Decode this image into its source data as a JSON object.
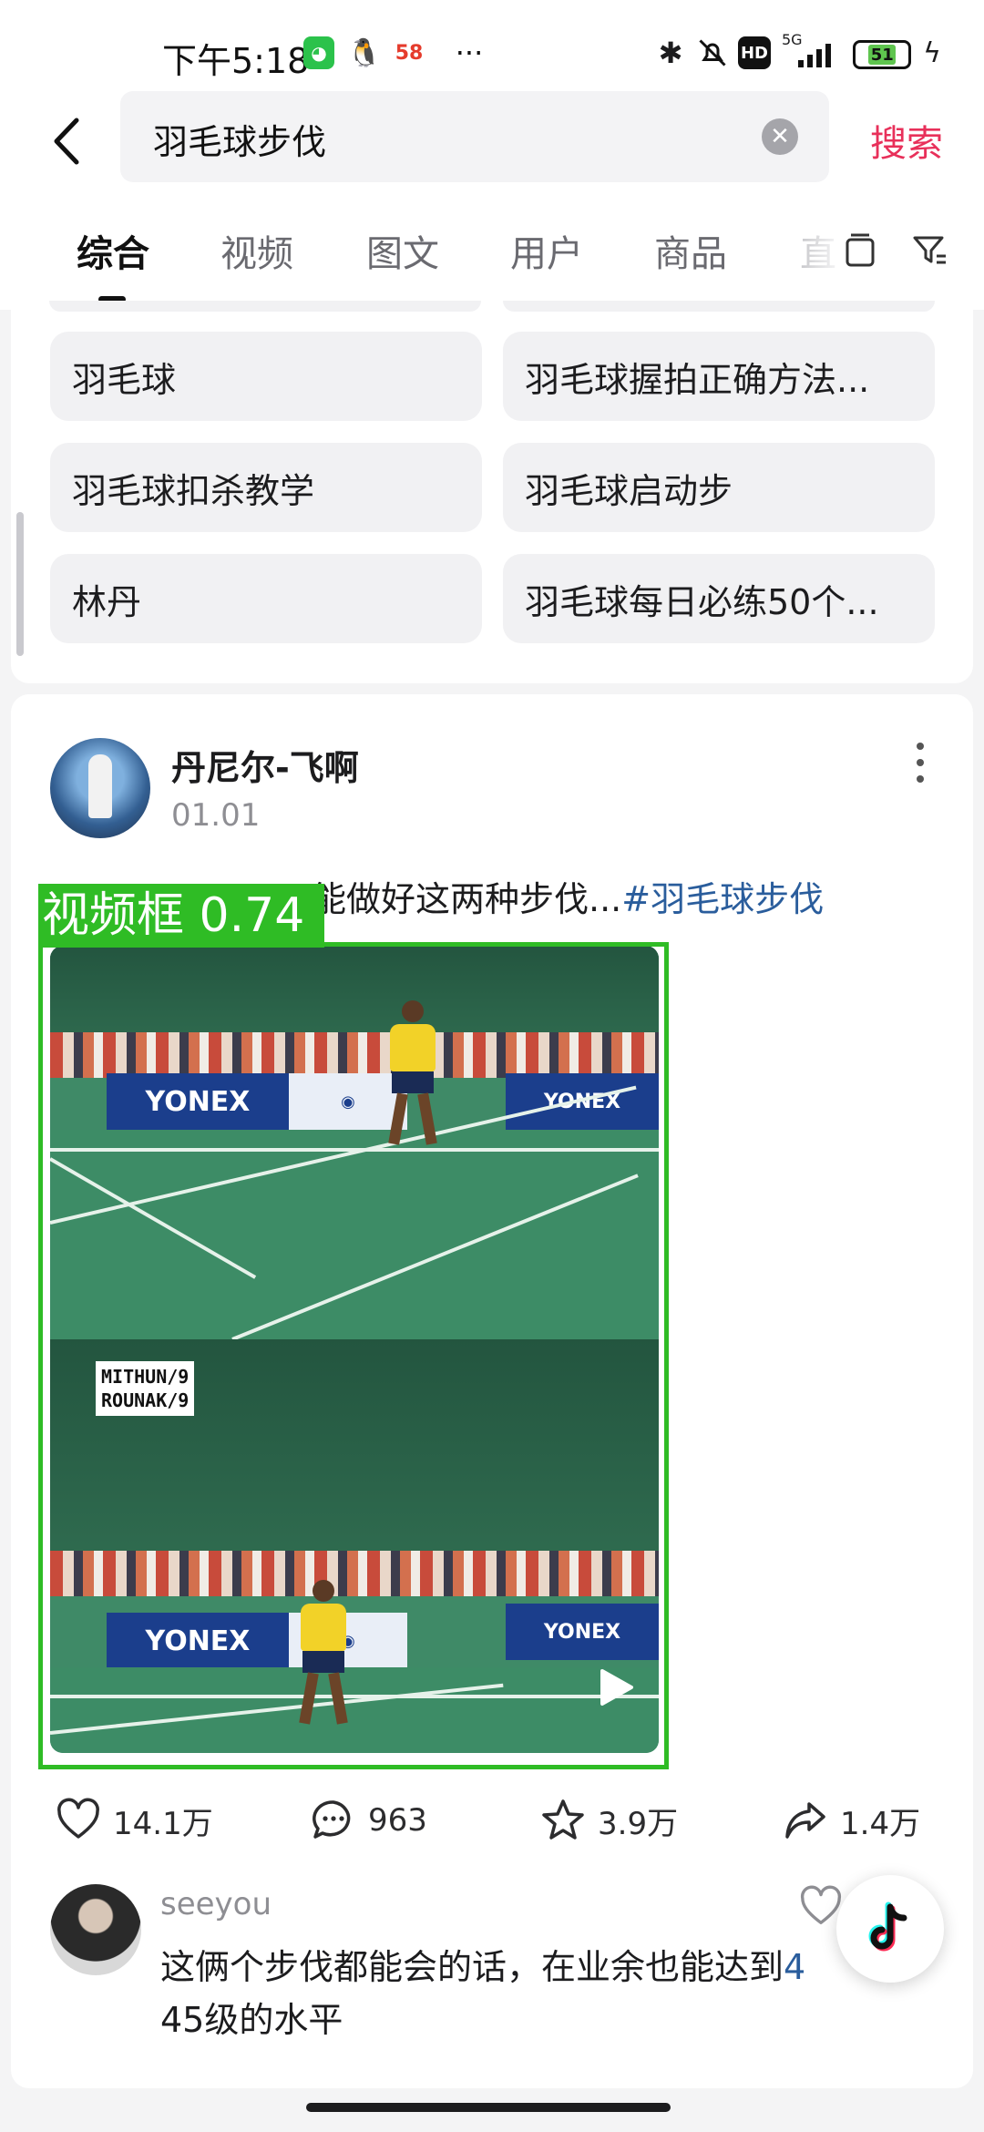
{
  "status_bar": {
    "time": "下午5:18",
    "app_58_label": "58",
    "network": "5G",
    "hd": "HD",
    "battery": "51"
  },
  "search": {
    "query": "羽毛球步伐",
    "submit_label": "搜索"
  },
  "tabs": [
    {
      "label": "综合",
      "active": true
    },
    {
      "label": "视频"
    },
    {
      "label": "图文"
    },
    {
      "label": "用户"
    },
    {
      "label": "商品"
    },
    {
      "label": "直"
    }
  ],
  "suggestions": [
    "羽毛球",
    "羽毛球握拍正确方法...",
    "羽毛球扣杀教学",
    "羽毛球启动步",
    "林丹",
    "羽毛球每日必练50个..."
  ],
  "post": {
    "author": "丹尼尔-飞啊",
    "date": "01.01",
    "text": "能做好这两种步伐...",
    "hashtag": "#羽毛球步伐",
    "video_score_overlay": [
      "MITHUN/9",
      "ROUNAK/9"
    ],
    "banner_text": "YONEX",
    "stats": {
      "likes": "14.1万",
      "comments": "963",
      "favorites": "3.9万",
      "shares": "1.4万"
    }
  },
  "detection": {
    "label": "视频框 0.74",
    "color": "#2fbc25"
  },
  "comment": {
    "user": "seeyou",
    "text": "这俩个步伐都能会的话，在业余也能达到",
    "text_link_fragment": "4",
    "text_line2": "45级的水平"
  },
  "colors": {
    "accent": "#e8305a",
    "hashtag": "#2a5d9c"
  }
}
